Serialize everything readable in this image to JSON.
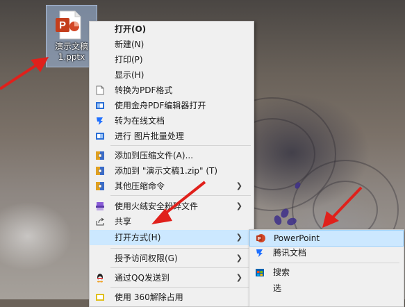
{
  "desktop": {
    "file": {
      "name_line1": "演示文稿",
      "name_line2": "1.pptx",
      "icon": "powerpoint-file-icon"
    }
  },
  "context_menu": {
    "items": [
      {
        "label": "打开(O)",
        "icon": "",
        "bold": true
      },
      {
        "label": "新建(N)",
        "icon": ""
      },
      {
        "label": "打印(P)",
        "icon": ""
      },
      {
        "label": "显示(H)",
        "icon": ""
      },
      {
        "label": "转换为PDF格式",
        "icon": "document-icon"
      },
      {
        "label": "使用金舟PDF编辑器打开",
        "icon": "pdf-editor-icon"
      },
      {
        "label": "转为在线文档",
        "icon": "tencent-docs-icon"
      },
      {
        "label": "进行 图片批量处理",
        "icon": "image-batch-icon"
      },
      {
        "label": "添加到压缩文件(A)...",
        "icon": "archive-icon"
      },
      {
        "label": "添加到 \"演示文稿1.zip\" (T)",
        "icon": "archive-icon"
      },
      {
        "label": "其他压缩命令",
        "icon": "archive-icon",
        "submenu": true
      },
      {
        "label": "使用火绒安全粉碎文件",
        "icon": "shredder-icon",
        "submenu": true
      },
      {
        "label": "共享",
        "icon": "share-icon"
      },
      {
        "label": "打开方式(H)",
        "icon": "",
        "submenu": true,
        "highlighted": true
      },
      {
        "label": "授予访问权限(G)",
        "icon": "",
        "submenu": true
      },
      {
        "label": "通过QQ发送到",
        "icon": "qq-icon",
        "submenu": true
      },
      {
        "label": "使用 360解除占用",
        "icon": "360-icon"
      }
    ]
  },
  "open_with_submenu": {
    "items": [
      {
        "label": "PowerPoint",
        "icon": "powerpoint-icon",
        "highlighted": true
      },
      {
        "label": "腾讯文档",
        "icon": "tencent-docs-icon"
      },
      {
        "label": "搜索",
        "icon": "store-icon"
      },
      {
        "label": "选",
        "icon": ""
      }
    ]
  },
  "colors": {
    "highlight": "#cce8ff",
    "menu_bg": "#f0f0f0",
    "arrow": "#e0201b",
    "ppt": "#d24726"
  }
}
